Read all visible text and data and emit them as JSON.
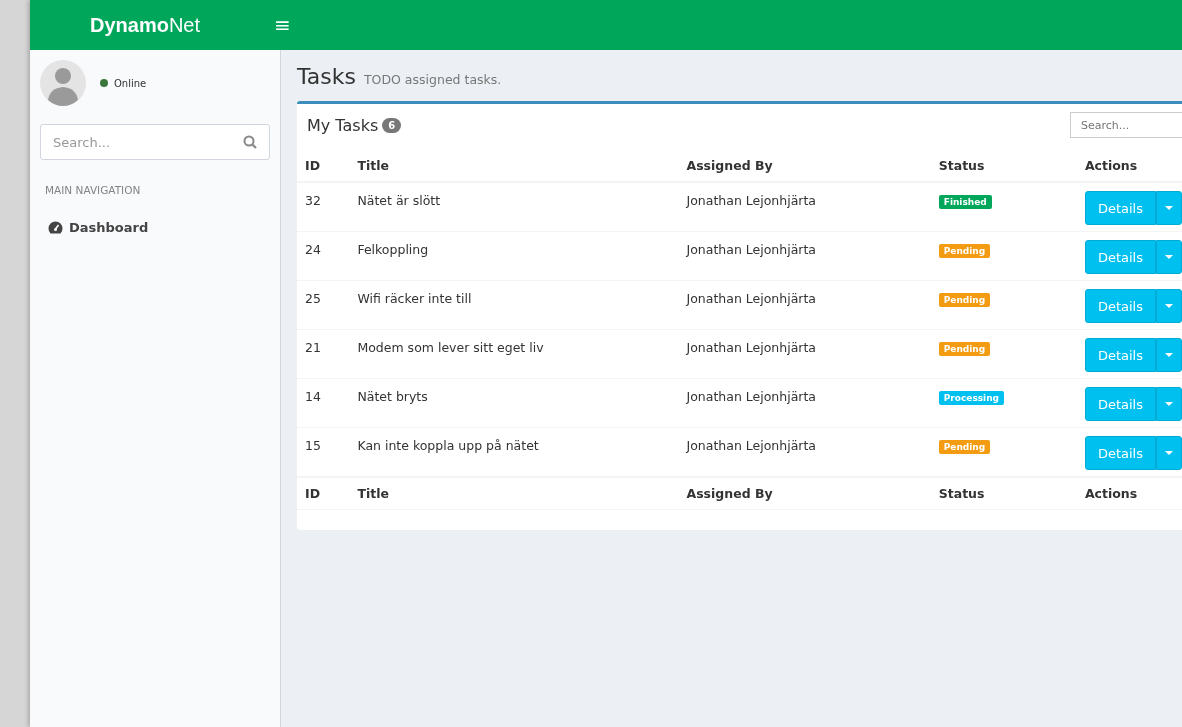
{
  "header": {
    "logo_bold": "Dynamo",
    "logo_rest": "Net",
    "menu_icon": "≡"
  },
  "sidebar": {
    "user_status": "Online",
    "search": {
      "placeholder": "Search..."
    },
    "section": "MAIN NAVIGATION",
    "items": [
      {
        "label": "Dashboard",
        "selected": false
      }
    ]
  },
  "page": {
    "title": "Tasks",
    "subtitle": "TODO assigned tasks."
  },
  "card": {
    "title": "My Tasks",
    "count": "6",
    "search": {
      "placeholder": "Search..."
    }
  },
  "table": {
    "columns": [
      "ID",
      "Title",
      "Assigned By",
      "Status",
      "Actions"
    ],
    "rows": [
      {
        "id": "32",
        "title": "Nätet är slött",
        "assigned_by": "Jonathan Lejonhjärta",
        "status": "Finished",
        "color": "#00a65a",
        "action": "Details"
      },
      {
        "id": "24",
        "title": "Felkoppling",
        "assigned_by": "Jonathan Lejonhjärta",
        "status": "Pending",
        "color": "#f39c12",
        "action": "Details"
      },
      {
        "id": "25",
        "title": "Wifi räcker inte till",
        "assigned_by": "Jonathan Lejonhjärta",
        "status": "Pending",
        "color": "#f39c12",
        "action": "Details"
      },
      {
        "id": "21",
        "title": "Modem som lever sitt eget liv",
        "assigned_by": "Jonathan Lejonhjärta",
        "status": "Pending",
        "color": "#f39c12",
        "action": "Details"
      },
      {
        "id": "14",
        "title": "Nätet bryts",
        "assigned_by": "Jonathan Lejonhjärta",
        "status": "Processing",
        "color": "#00c0ef",
        "action": "Details"
      },
      {
        "id": "15",
        "title": "Kan inte koppla upp på nätet",
        "assigned_by": "Jonathan Lejonhjärta",
        "status": "Pending",
        "color": "#f39c12",
        "action": "Details"
      }
    ],
    "footer_columns": [
      "ID",
      "Title",
      "Assigned By",
      "Status",
      "Actions"
    ]
  }
}
